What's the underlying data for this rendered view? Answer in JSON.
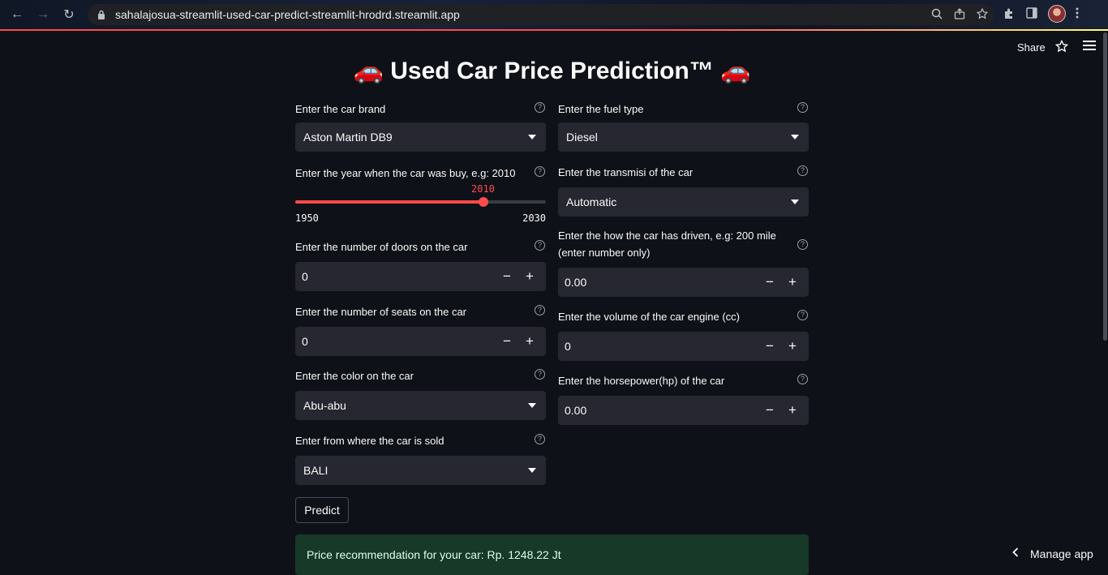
{
  "browser": {
    "url": "sahalajosua-streamlit-used-car-predict-streamlit-hrodrd.streamlit.app"
  },
  "header": {
    "share_label": "Share"
  },
  "app": {
    "title": "🚗 Used Car Price Prediction™ 🚗"
  },
  "form": {
    "brand": {
      "label": "Enter the car brand",
      "value": "Aston Martin DB9"
    },
    "year": {
      "label": "Enter the year when the car was buy, e.g: 2010",
      "value": "2010",
      "min": "1950",
      "max": "2030",
      "fraction": 0.75
    },
    "doors": {
      "label": "Enter the number of doors on the car",
      "value": "0"
    },
    "seats": {
      "label": "Enter the number of seats on the car",
      "value": "0"
    },
    "color": {
      "label": "Enter the color on the car",
      "value": "Abu-abu"
    },
    "location": {
      "label": "Enter from where the car is sold",
      "value": "BALI"
    },
    "fuel": {
      "label": "Enter the fuel type",
      "value": "Diesel"
    },
    "transmission": {
      "label": "Enter the transmisi of the car",
      "value": "Automatic"
    },
    "mileage": {
      "label": "Enter the how the car has driven, e.g: 200 mile (enter number only)",
      "value": "0.00"
    },
    "engine": {
      "label": "Enter the volume of the car engine (cc)",
      "value": "0"
    },
    "horsepower": {
      "label": "Enter the horsepower(hp) of the car",
      "value": "0.00"
    },
    "predict_label": "Predict"
  },
  "result": {
    "text": "Price recommendation for your car: Rp. 1248.22 Jt"
  },
  "footer": {
    "manage_label": "Manage app"
  },
  "colors": {
    "accent": "#ff4b4b",
    "background": "#0e1117",
    "input_bg": "#262730",
    "success_bg": "#173928"
  }
}
